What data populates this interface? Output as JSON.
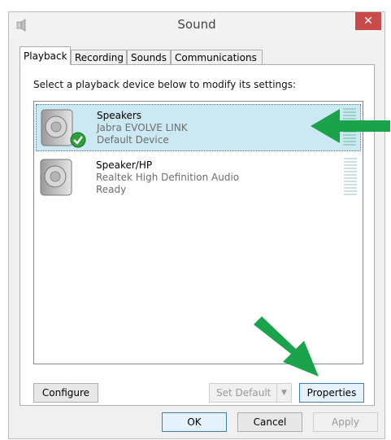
{
  "window": {
    "title": "Sound",
    "close_glyph": "✕"
  },
  "tabs": [
    {
      "label": "Playback",
      "active": true
    },
    {
      "label": "Recording",
      "active": false
    },
    {
      "label": "Sounds",
      "active": false
    },
    {
      "label": "Communications",
      "active": false
    }
  ],
  "panel": {
    "instruction": "Select a playback device below to modify its settings:"
  },
  "devices": [
    {
      "name": "Speakers",
      "description": "Jabra EVOLVE LINK",
      "status": "Default Device",
      "selected": true,
      "default": true
    },
    {
      "name": "Speaker/HP",
      "description": "Realtek High Definition Audio",
      "status": "Ready",
      "selected": false,
      "default": false
    }
  ],
  "buttons": {
    "configure": "Configure",
    "set_default": "Set Default",
    "properties": "Properties",
    "ok": "OK",
    "cancel": "Cancel",
    "apply": "Apply"
  },
  "colors": {
    "annotation_arrow": "#1aa34a",
    "selection": "#cce8f3",
    "close": "#c94a4a"
  },
  "icons": {
    "app": "sound-app-icon",
    "speaker": "speaker-icon",
    "default_check": "green-check-icon"
  }
}
